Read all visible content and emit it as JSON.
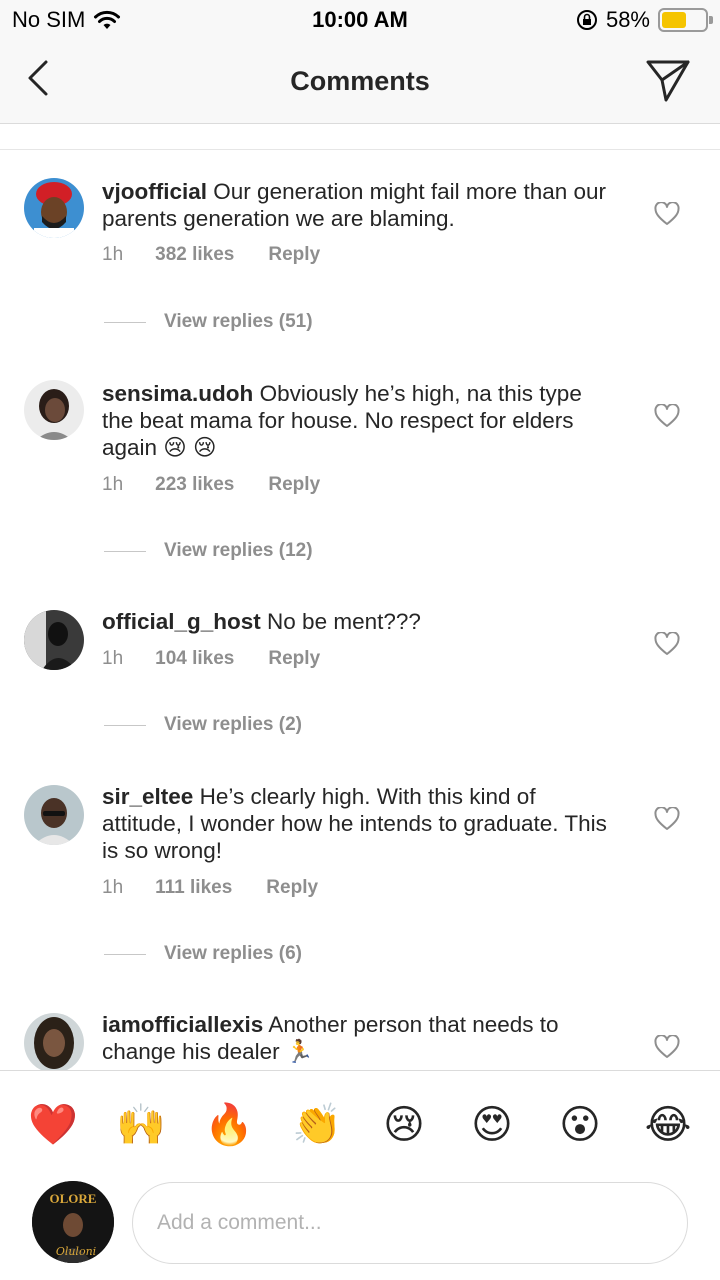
{
  "status_bar": {
    "carrier": "No SIM",
    "time": "10:00 AM",
    "battery": "58%",
    "battery_level": 0.58,
    "icons": [
      "wifi-icon",
      "orientation-lock-icon",
      "battery-icon"
    ]
  },
  "header": {
    "title": "Comments",
    "back_icon": "chevron-left-icon",
    "send_icon": "paper-plane-icon"
  },
  "comments": [
    {
      "username": "vjoofficial",
      "text": "Our generation might fail more than our parents generation we are blaming.",
      "time": "1h",
      "likes": "382 likes",
      "reply": "Reply",
      "view_replies": "View replies (51)"
    },
    {
      "username": "sensima.udoh",
      "text": "Obviously he’s high, na this type the beat mama for house. No respect for elders again 😢 😢",
      "time": "1h",
      "likes": "223 likes",
      "reply": "Reply",
      "view_replies": "View replies (12)"
    },
    {
      "username": "official_g_host",
      "text": "No be ment???",
      "time": "1h",
      "likes": "104 likes",
      "reply": "Reply",
      "view_replies": "View replies (2)"
    },
    {
      "username": "sir_eltee",
      "text": "He’s clearly high. With this kind of attitude, I wonder how he intends to graduate. This is so wrong!",
      "time": "1h",
      "likes": "111 likes",
      "reply": "Reply",
      "view_replies": "View replies (6)"
    },
    {
      "username": "iamofficiallexis",
      "text": "Another person that needs to change his dealer 🏃",
      "time": "",
      "likes": "",
      "reply": "",
      "view_replies": ""
    }
  ],
  "emoji_bar": [
    "❤️",
    "🙌",
    "🔥",
    "👏",
    "😢",
    "😍",
    "😮",
    "😂"
  ],
  "composer": {
    "placeholder": "Add a comment...",
    "avatar_logo_text": "OLORE",
    "avatar_script_text": "Oluloni"
  },
  "colors": {
    "heart_red": "#e8262f",
    "muted_text": "#8e8e8e",
    "battery_yellow": "#f5c400"
  }
}
